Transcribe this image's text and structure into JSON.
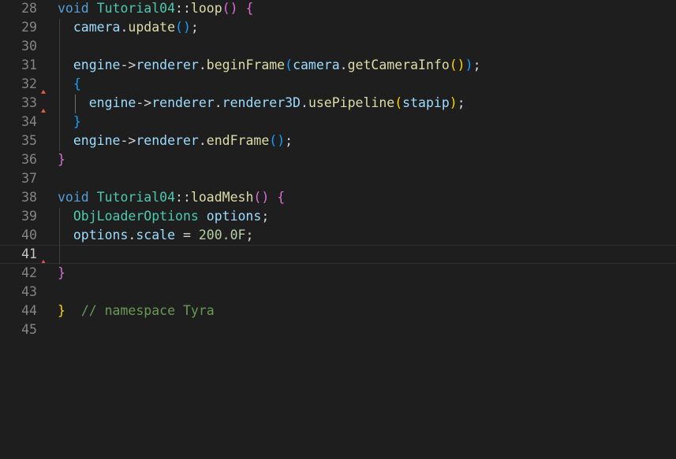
{
  "editor": {
    "colors": {
      "background": "#1e1e1e",
      "line_number": "#858585",
      "keyword": "#569cd6",
      "type": "#4ec9b0",
      "function": "#dcdcaa",
      "variable": "#9cdcfe",
      "number": "#b5cea8",
      "comment": "#6a9955",
      "bracket_gold": "#ffd700",
      "bracket_orchid": "#da70d6",
      "bracket_blue": "#179fff",
      "fold_marker": "#e05d44"
    },
    "current_line": "41",
    "lines": [
      {
        "number": "28",
        "tokens": [
          {
            "t": "void",
            "c": "kw"
          },
          {
            "t": " "
          },
          {
            "t": "Tutorial04",
            "c": "typ"
          },
          {
            "t": "::"
          },
          {
            "t": "loop",
            "c": "fn"
          },
          {
            "t": "()",
            "c": "b2"
          },
          {
            "t": " "
          },
          {
            "t": "{",
            "c": "b2"
          }
        ]
      },
      {
        "number": "29",
        "tokens": [
          {
            "t": "  "
          },
          {
            "t": "camera",
            "c": "var"
          },
          {
            "t": "."
          },
          {
            "t": "update",
            "c": "fn"
          },
          {
            "t": "()",
            "c": "b3"
          },
          {
            "t": ";"
          }
        ]
      },
      {
        "number": "30",
        "tokens": []
      },
      {
        "number": "31",
        "tokens": [
          {
            "t": "  "
          },
          {
            "t": "engine",
            "c": "var"
          },
          {
            "t": "->"
          },
          {
            "t": "renderer",
            "c": "var"
          },
          {
            "t": "."
          },
          {
            "t": "beginFrame",
            "c": "fn"
          },
          {
            "t": "(",
            "c": "b3"
          },
          {
            "t": "camera",
            "c": "var"
          },
          {
            "t": "."
          },
          {
            "t": "getCameraInfo",
            "c": "fn"
          },
          {
            "t": "()",
            "c": "b1"
          },
          {
            "t": ")",
            "c": "b3"
          },
          {
            "t": ";"
          }
        ]
      },
      {
        "number": "32",
        "tokens": [
          {
            "t": "  "
          },
          {
            "t": "{",
            "c": "b3"
          }
        ]
      },
      {
        "number": "33",
        "tokens": [
          {
            "t": "    "
          },
          {
            "t": "engine",
            "c": "var"
          },
          {
            "t": "->"
          },
          {
            "t": "renderer",
            "c": "var"
          },
          {
            "t": "."
          },
          {
            "t": "renderer3D",
            "c": "var"
          },
          {
            "t": "."
          },
          {
            "t": "usePipeline",
            "c": "fn"
          },
          {
            "t": "(",
            "c": "b1"
          },
          {
            "t": "stapip",
            "c": "var"
          },
          {
            "t": ")",
            "c": "b1"
          },
          {
            "t": ";"
          }
        ]
      },
      {
        "number": "34",
        "tokens": [
          {
            "t": "  "
          },
          {
            "t": "}",
            "c": "b3"
          }
        ]
      },
      {
        "number": "35",
        "tokens": [
          {
            "t": "  "
          },
          {
            "t": "engine",
            "c": "var"
          },
          {
            "t": "->"
          },
          {
            "t": "renderer",
            "c": "var"
          },
          {
            "t": "."
          },
          {
            "t": "endFrame",
            "c": "fn"
          },
          {
            "t": "()",
            "c": "b3"
          },
          {
            "t": ";"
          }
        ]
      },
      {
        "number": "36",
        "tokens": [
          {
            "t": "}",
            "c": "b2"
          }
        ]
      },
      {
        "number": "37",
        "tokens": []
      },
      {
        "number": "38",
        "tokens": [
          {
            "t": "void",
            "c": "kw"
          },
          {
            "t": " "
          },
          {
            "t": "Tutorial04",
            "c": "typ"
          },
          {
            "t": "::"
          },
          {
            "t": "loadMesh",
            "c": "fn"
          },
          {
            "t": "()",
            "c": "b2"
          },
          {
            "t": " "
          },
          {
            "t": "{",
            "c": "b2"
          }
        ]
      },
      {
        "number": "39",
        "tokens": [
          {
            "t": "  "
          },
          {
            "t": "ObjLoaderOptions",
            "c": "typ"
          },
          {
            "t": " "
          },
          {
            "t": "options",
            "c": "var"
          },
          {
            "t": ";"
          }
        ]
      },
      {
        "number": "40",
        "tokens": [
          {
            "t": "  "
          },
          {
            "t": "options",
            "c": "var"
          },
          {
            "t": "."
          },
          {
            "t": "scale",
            "c": "var"
          },
          {
            "t": " = "
          },
          {
            "t": "200.0F",
            "c": "num"
          },
          {
            "t": ";"
          }
        ]
      },
      {
        "number": "41",
        "tokens": []
      },
      {
        "number": "42",
        "tokens": [
          {
            "t": "}",
            "c": "b2"
          }
        ]
      },
      {
        "number": "43",
        "tokens": []
      },
      {
        "number": "44",
        "tokens": [
          {
            "t": "}",
            "c": "b1"
          },
          {
            "t": "  "
          },
          {
            "t": "// namespace Tyra",
            "c": "cm"
          }
        ]
      },
      {
        "number": "45",
        "tokens": []
      }
    ]
  }
}
